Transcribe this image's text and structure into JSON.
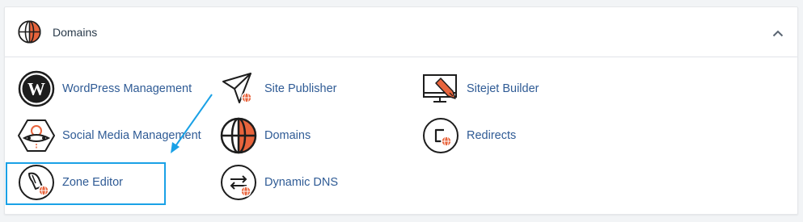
{
  "section": {
    "title": "Domains",
    "header_icon": "globe-icon",
    "collapse_icon": "chevron-up-icon"
  },
  "items": [
    {
      "label": "WordPress Management",
      "icon": "wordpress-icon"
    },
    {
      "label": "Site Publisher",
      "icon": "paper-plane-icon"
    },
    {
      "label": "Sitejet Builder",
      "icon": "monitor-pencil-icon"
    },
    {
      "label": "Social Media Management",
      "icon": "social-media-icon"
    },
    {
      "label": "Domains",
      "icon": "globe-icon"
    },
    {
      "label": "Redirects",
      "icon": "redirect-icon"
    },
    {
      "label": "Zone Editor",
      "icon": "zone-editor-icon"
    },
    {
      "label": "Dynamic DNS",
      "icon": "dynamic-dns-icon"
    }
  ],
  "colors": {
    "accent": "#e8643c",
    "link": "#2f5b95",
    "annotation": "#1aa1e6"
  }
}
